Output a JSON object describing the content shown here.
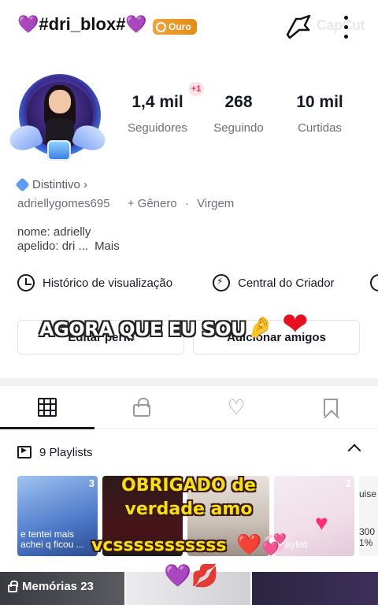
{
  "header": {
    "username": "💜#dri_blox#💜",
    "badge_label": "Ouro",
    "watermark": "CapCut"
  },
  "profile": {
    "new_followers_badge": "+1",
    "stats": [
      {
        "value": "1,4 mil",
        "label": "Seguidores"
      },
      {
        "value": "268",
        "label": "Seguindo"
      },
      {
        "value": "10 mil",
        "label": "Curtidas"
      }
    ],
    "distintivo": "Distintivo",
    "handle": "adriellygomes695",
    "gender": "+ Gênero",
    "separator": "·",
    "zodiac": "Virgem",
    "bio_line1": "nome: adrielly",
    "bio_line2": "apelido: dri ...",
    "bio_more": "Mais"
  },
  "shortcuts": {
    "history": "Histórico de visualização",
    "creator_center": "Central do Criador"
  },
  "buttons": {
    "edit_profile": "Editar perfil",
    "add_friends": "Adicionar amigos"
  },
  "overlay": {
    "caption1": "AGORA QUE EU SOU",
    "caption1_emoji": "🤌",
    "caption1_heart": "❤",
    "caption2_line1": "OBRIGADO de",
    "caption2_line2": "verdade amo",
    "caption3": "vcsssssssssss",
    "caption3_emojis": "❤️💞",
    "bottom_emojis": "💜💋"
  },
  "tabs": [
    "grid",
    "private",
    "liked",
    "saved"
  ],
  "playlists": {
    "title": "9 Playlists",
    "thumbs": [
      {
        "count": "3",
        "text": "e tentei mais achei q ficou ..."
      },
      {
        "count": "",
        "text": ""
      },
      {
        "count": "",
        "text": ""
      },
      {
        "count": "2",
        "text": "Playlist"
      },
      {
        "count": "",
        "text_top": "uise",
        "text_bottom": "300 1%"
      }
    ]
  },
  "bottom": {
    "memorias": "Memórias 23"
  },
  "colors": {
    "accent_red": "#fe2c55",
    "badge_gold": "#e38b17",
    "caption_yellow": "#f5e10c"
  }
}
